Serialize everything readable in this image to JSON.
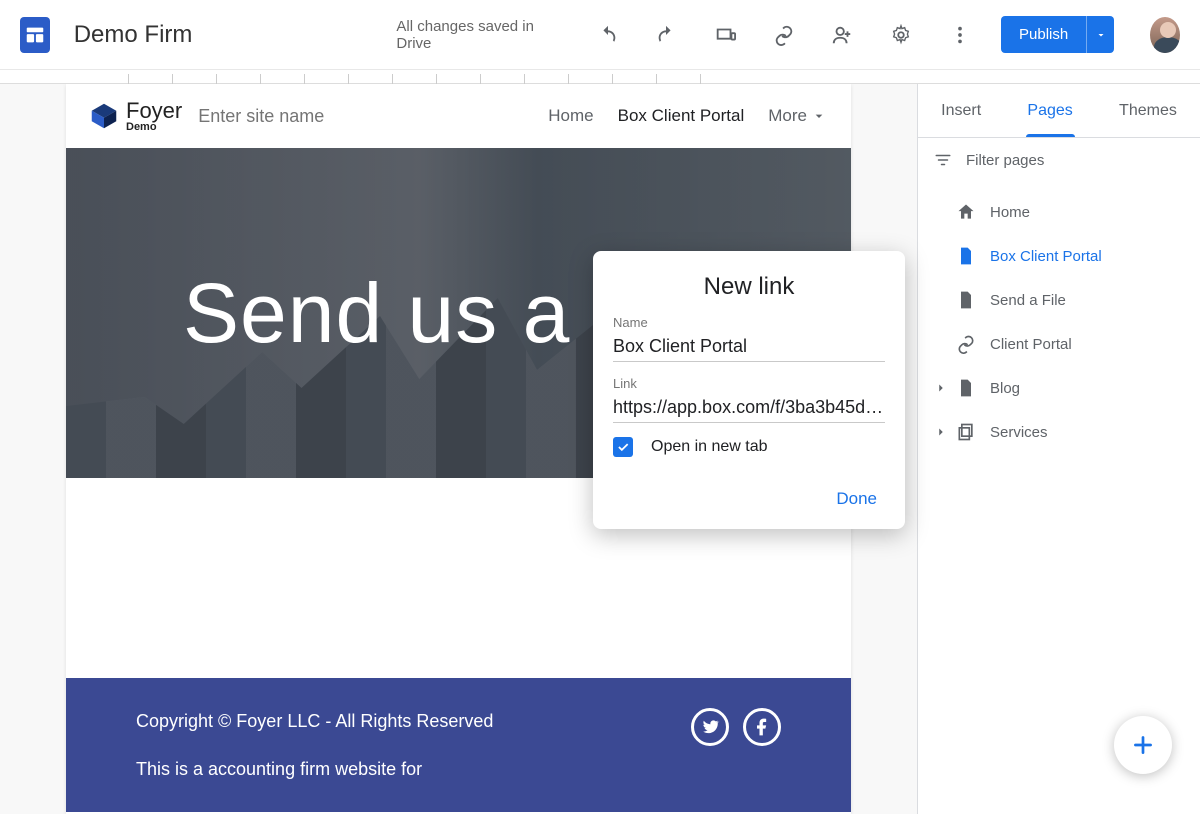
{
  "header": {
    "doc_title": "Demo Firm",
    "save_status": "All changes saved in Drive",
    "publish_label": "Publish"
  },
  "site": {
    "logo_line1": "Foyer",
    "logo_line2": "Demo",
    "name_placeholder": "Enter site name",
    "nav": {
      "home": "Home",
      "active": "Box Client Portal",
      "more": "More"
    },
    "hero_title": "Send us a File"
  },
  "footer": {
    "copyright": "Copyright © Foyer LLC - All Rights Reserved",
    "desc": "This is a accounting firm website for"
  },
  "sidepanel": {
    "tabs": {
      "insert": "Insert",
      "pages": "Pages",
      "themes": "Themes"
    },
    "filter_placeholder": "Filter pages",
    "pages": [
      {
        "label": "Home",
        "icon": "home"
      },
      {
        "label": "Box Client Portal",
        "icon": "page",
        "selected": true
      },
      {
        "label": "Send a File",
        "icon": "page"
      },
      {
        "label": "Client Portal",
        "icon": "link"
      },
      {
        "label": "Blog",
        "icon": "page",
        "expandable": true
      },
      {
        "label": "Services",
        "icon": "copy",
        "expandable": true
      }
    ]
  },
  "dialog": {
    "title": "New link",
    "name_label": "Name",
    "name_value": "Box Client Portal",
    "link_label": "Link",
    "link_value": "https://app.box.com/f/3ba3b45d…",
    "open_new_tab_label": "Open in new tab",
    "open_new_tab_checked": true,
    "done_label": "Done"
  }
}
